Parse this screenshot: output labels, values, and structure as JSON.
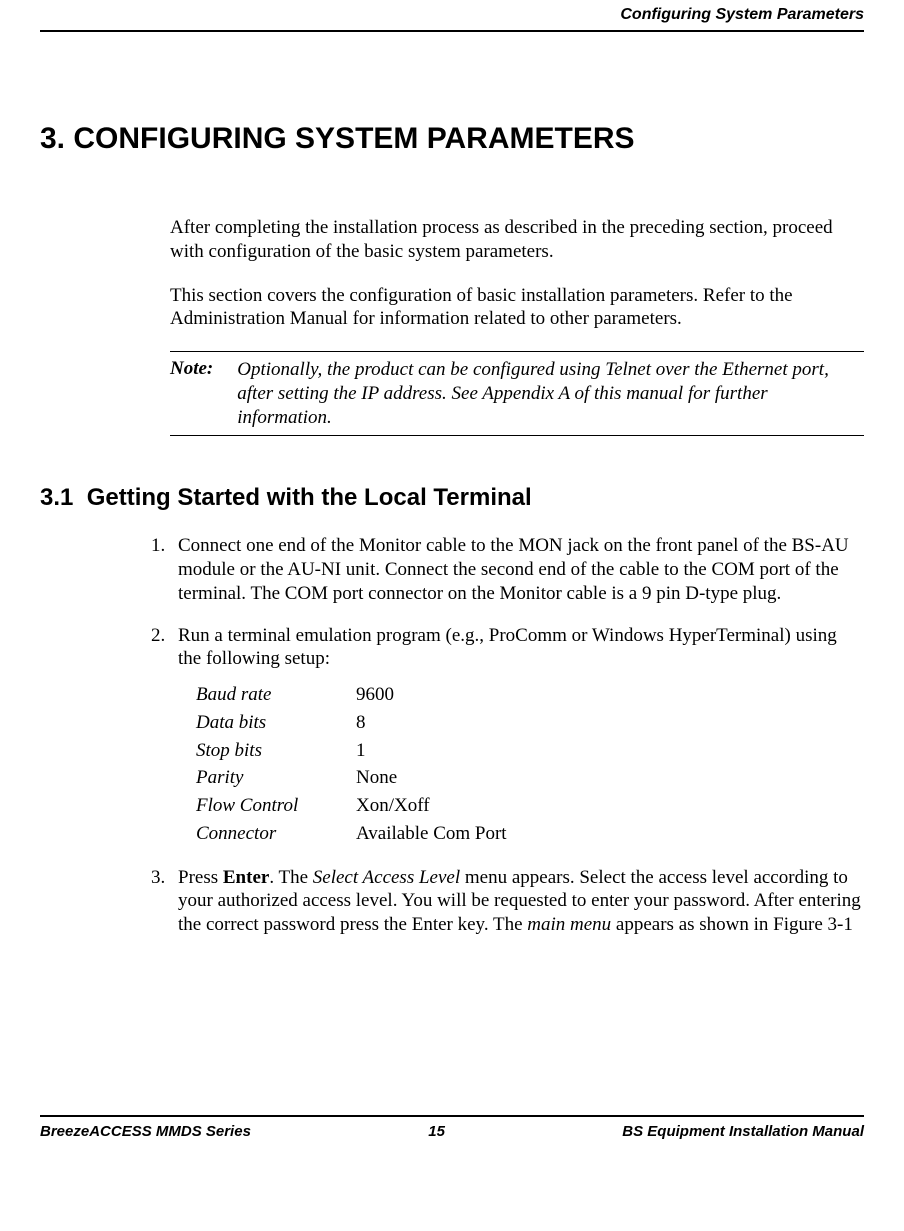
{
  "header": {
    "title": "Configuring System Parameters"
  },
  "chapter": {
    "number": "3.",
    "title": "CONFIGURING SYSTEM PARAMETERS"
  },
  "intro": {
    "para1": "After completing the installation process as described in the preceding section, proceed with configuration of the basic system parameters.",
    "para2": "This section covers the configuration of basic installation parameters. Refer to the Administration Manual for information related to other parameters."
  },
  "note": {
    "label": "Note:",
    "text": "Optionally, the product can be configured using Telnet over the Ethernet port, after setting the IP address. See Appendix A of this manual for further information."
  },
  "section": {
    "number": "3.1",
    "title": "Getting Started with the Local Terminal"
  },
  "steps": {
    "s1": "Connect one end of the Monitor cable to the MON jack on the front panel of the BS-AU module or the AU-NI unit. Connect the second end of the cable to the COM port of the terminal. The COM port connector on the Monitor cable is a 9 pin D-type plug.",
    "s2": "Run a terminal emulation program (e.g., ProComm or Windows HyperTerminal) using the following setup:",
    "s3_pre": "Press ",
    "s3_enter": "Enter",
    "s3_mid1": ". The ",
    "s3_sel": "Select Access Level",
    "s3_mid2": " menu appears. Select the access level according to your authorized access level. You will be requested to enter your password. After entering the correct password press the Enter key. The ",
    "s3_mainmenu": "main menu",
    "s3_post": " appears as shown in Figure 3-1"
  },
  "settings": [
    {
      "name": "Baud rate",
      "value": "9600"
    },
    {
      "name": "Data bits",
      "value": "8"
    },
    {
      "name": "Stop bits",
      "value": "1"
    },
    {
      "name": "Parity",
      "value": "None"
    },
    {
      "name": "Flow Control",
      "value": "Xon/Xoff"
    },
    {
      "name": "Connector",
      "value": "Available Com Port"
    }
  ],
  "footer": {
    "left": "BreezeACCESS MMDS Series",
    "center": "15",
    "right": "BS Equipment Installation Manual"
  }
}
